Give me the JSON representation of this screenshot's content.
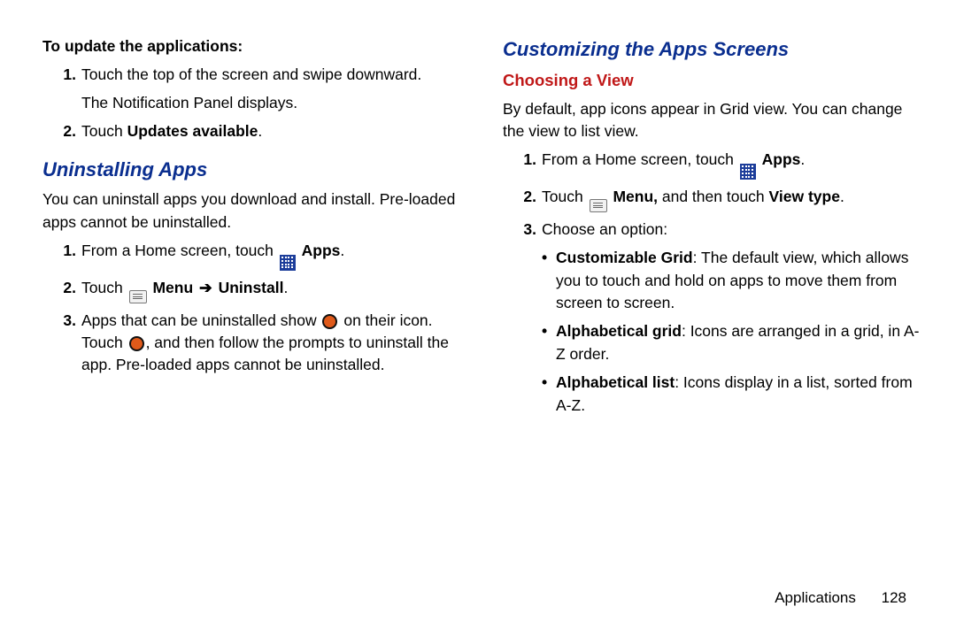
{
  "left": {
    "update_heading": "To update the applications:",
    "update_steps": {
      "s1a": "Touch the top of the screen and swipe downward.",
      "s1b": "The Notification Panel displays.",
      "s2_pre": "Touch ",
      "s2_bold": "Updates available",
      "s2_post": "."
    },
    "uninstall_heading": "Uninstalling Apps",
    "uninstall_para": "You can uninstall apps you download and install. Pre-loaded apps cannot be uninstalled.",
    "uninstall_steps": {
      "s1_pre": "From a Home screen, touch ",
      "s1_bold": "Apps",
      "s1_post": ".",
      "s2_pre": "Touch ",
      "s2_menu": "Menu",
      "s2_arrow": "➔",
      "s2_uninstall": "Uninstall",
      "s2_post": ".",
      "s3_a": "Apps that can be uninstalled show ",
      "s3_b": " on their icon. Touch ",
      "s3_c": ", and then follow the prompts to uninstall the app. Pre-loaded apps cannot be uninstalled."
    }
  },
  "right": {
    "customize_heading": "Customizing the Apps Screens",
    "choosing_heading": "Choosing a View",
    "choosing_para": "By default, app icons appear in Grid view. You can change the view to list view.",
    "steps": {
      "s1_pre": "From a Home screen, touch ",
      "s1_bold": "Apps",
      "s1_post": ".",
      "s2_pre": "Touch ",
      "s2_menu": "Menu,",
      "s2_mid": " and then touch ",
      "s2_view": "View type",
      "s2_post": ".",
      "s3": "Choose an option:"
    },
    "options": {
      "o1_bold": "Customizable Grid",
      "o1_rest": ": The default view, which allows you to touch and hold on apps to move them from screen to screen.",
      "o2_bold": "Alphabetical grid",
      "o2_rest": ": Icons are arranged in a grid, in A-Z order.",
      "o3_bold": "Alphabetical list",
      "o3_rest": ": Icons display in a list, sorted from A-Z."
    }
  },
  "footer": {
    "section": "Applications",
    "page": "128"
  }
}
